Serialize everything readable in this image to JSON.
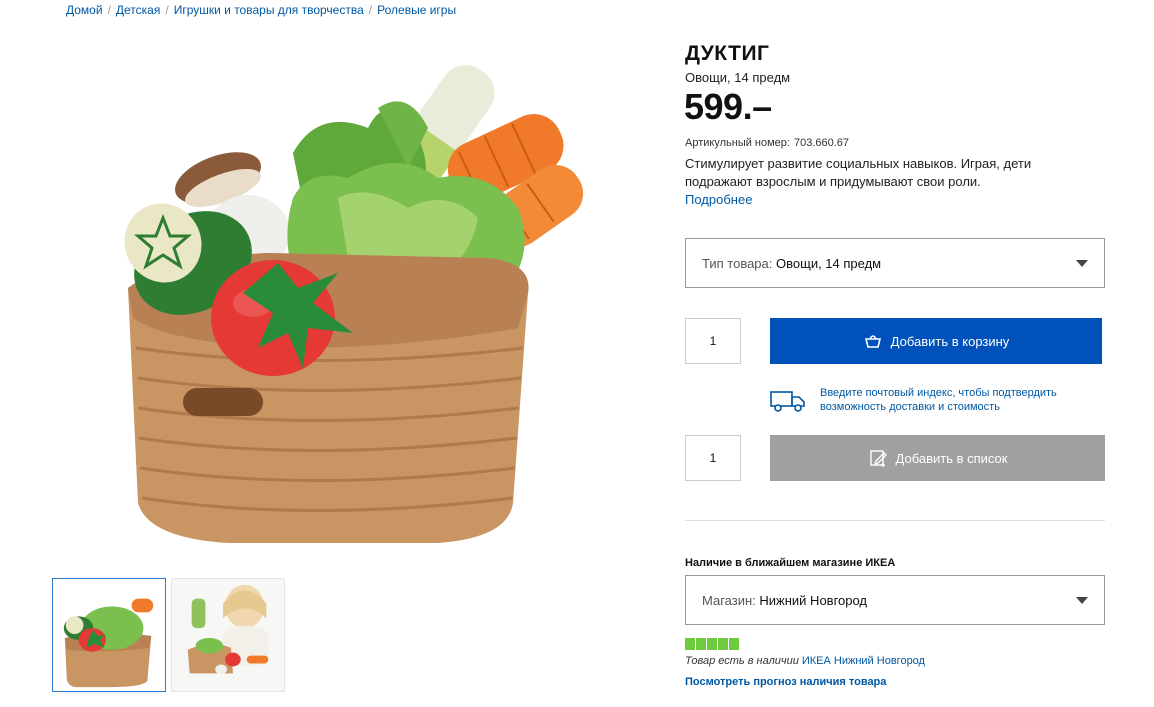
{
  "breadcrumb": [
    {
      "label": "Домой"
    },
    {
      "label": "Детская"
    },
    {
      "label": "Игрушки и товары для творчества"
    },
    {
      "label": "Ролевые игры"
    }
  ],
  "product": {
    "name": "ДУКТИГ",
    "type": "Овощи, 14 предм",
    "price": "599.–",
    "article_label": "Артикульный номер:",
    "article_number": "703.660.67",
    "description": "Стимулирует развитие социальных навыков. Играя, дети подражают взрослым и придумывают свои роли.",
    "more_link": "Подробнее"
  },
  "type_select": {
    "label": "Тип товара:",
    "value": "Овощи, 14 предм"
  },
  "cart": {
    "quantity": "1",
    "button_label": "Добавить в корзину",
    "icon": "basket-icon"
  },
  "delivery": {
    "text": "Введите почтовый индекс, чтобы подтвердить возможность доставки и стоимость",
    "icon": "truck-icon"
  },
  "wishlist": {
    "quantity": "1",
    "button_label": "Добавить в список",
    "icon": "list-edit-icon"
  },
  "availability": {
    "title": "Наличие в ближайшем магазине ИКЕА",
    "store_label": "Магазин:",
    "store_value": "Нижний Новгород",
    "stock_level": 1.0,
    "status_text": "Товар есть в наличии",
    "store_link": "ИКЕА Нижний Новгород",
    "forecast_link": "Посмотреть прогноз наличия товара"
  },
  "colors": {
    "accent": "#0051ba",
    "link": "#0058a3",
    "stock": "#6ecb3f",
    "disabled_button": "#a0a0a0"
  }
}
